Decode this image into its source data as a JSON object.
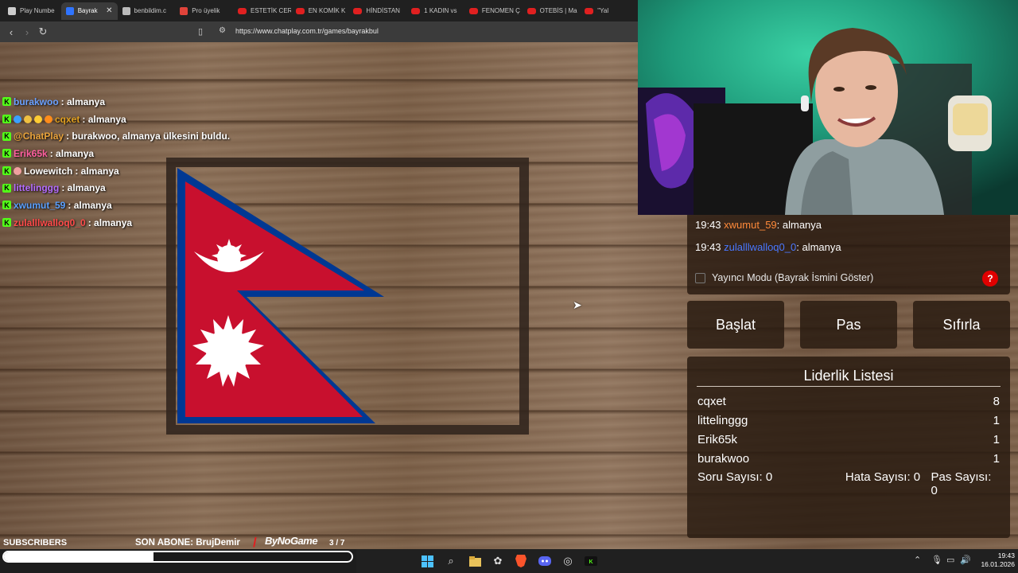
{
  "browser": {
    "tabs": [
      {
        "label": "Play Numbe",
        "favicon": "#cccccc",
        "active": false
      },
      {
        "label": "Bayrak",
        "favicon": "#2f74ff",
        "active": true
      },
      {
        "label": "benbildim.c",
        "favicon": "#bbbbbb",
        "active": false
      },
      {
        "label": "Pro üyelik",
        "favicon": "#e0433a",
        "active": false
      },
      {
        "label": "ESTETİK CER",
        "favicon": "yt",
        "active": false
      },
      {
        "label": "EN KOMİK K",
        "favicon": "yt",
        "active": false
      },
      {
        "label": "HİNDİSTAN",
        "favicon": "yt",
        "active": false
      },
      {
        "label": "1 KADIN vs",
        "favicon": "yt",
        "active": false
      },
      {
        "label": "FENOMEN Ç",
        "favicon": "yt",
        "active": false
      },
      {
        "label": "OTEBİS | Ma",
        "favicon": "yt",
        "active": false
      },
      {
        "label": "\"Yal",
        "favicon": "yt",
        "active": false
      }
    ],
    "close_symbol": "✕",
    "url": "https://www.chatplay.com.tr/games/bayrakbul"
  },
  "chat_overlay": [
    {
      "user": "burakwoo",
      "color": "#6aa0ff",
      "message": ": almanya",
      "extra_badges": 0
    },
    {
      "user": "cqxet",
      "color": "#e0a020",
      "message": ": almanya",
      "extra_badges": 4
    },
    {
      "user": "@ChatPlay",
      "color": "#e8a23a",
      "message": ": burakwoo, almanya ülkesini buldu.",
      "extra_badges": 0
    },
    {
      "user": "Erik65k",
      "color": "#ff5fa0",
      "message": ": almanya",
      "extra_badges": 0
    },
    {
      "user": "Lowewitch",
      "color": "#ffffff",
      "message": ": almanya",
      "extra_badges": 1
    },
    {
      "user": "littelinggg",
      "color": "#b36cff",
      "message": ": almanya",
      "extra_badges": 0
    },
    {
      "user": "xwumut_59",
      "color": "#5aa0ff",
      "message": ": almanya",
      "extra_badges": 0
    },
    {
      "user": "zulalllwalloq0_0",
      "color": "#ff4a4a",
      "message": ": almanya",
      "extra_badges": 0
    }
  ],
  "chat_badge_letter": "K",
  "game_chat": [
    {
      "time": "19:43",
      "user": "xwumut_59",
      "color": "#ff8a3a",
      "message": ": almanya"
    },
    {
      "time": "19:43",
      "user": "zulalllwalloq0_0",
      "color": "#4a78ff",
      "message": ": almanya"
    }
  ],
  "streamer_mode_label": "Yayıncı Modu (Bayrak İsmini Göster)",
  "help_label": "?",
  "buttons": {
    "start": "Başlat",
    "pass": "Pas",
    "reset": "Sıfırla"
  },
  "leaderboard": {
    "title": "Liderlik Listesi",
    "rows": [
      {
        "name": "cqxet",
        "score": "8"
      },
      {
        "name": "littelinggg",
        "score": "1"
      },
      {
        "name": "Erik65k",
        "score": "1"
      },
      {
        "name": "burakwoo",
        "score": "1"
      }
    ],
    "question_count": "Soru Sayısı: 0",
    "error_count": "Hata Sayısı: 0",
    "pass_count": "Pas Sayısı: 0"
  },
  "stream_overlay": {
    "subscribers_label": "SUBSCRIBERS",
    "last_sub_label": "SON ABONE:",
    "last_sub_name": "BrujDemir",
    "sponsor": "ByNoGame",
    "counter": "3 / 7",
    "progress": 0.43
  },
  "taskbar": {
    "time": "19:43",
    "date": "16.01.2026"
  },
  "colors": {
    "flag_red": "#c8102e",
    "flag_blue": "#003893",
    "accent_green": "#53fc18"
  }
}
